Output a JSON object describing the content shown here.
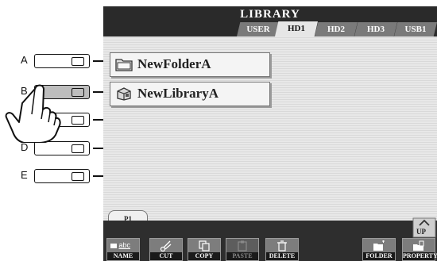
{
  "side_buttons": [
    {
      "label": "A"
    },
    {
      "label": "B"
    },
    {
      "label": ""
    },
    {
      "label": "D"
    },
    {
      "label": "E"
    }
  ],
  "screen": {
    "title": "LIBRARY",
    "tabs": [
      {
        "label": "USER"
      },
      {
        "label": "HD1",
        "active": true
      },
      {
        "label": "HD2"
      },
      {
        "label": "HD3"
      },
      {
        "label": "USB1"
      }
    ],
    "items": [
      {
        "name": "NewFolderA",
        "icon": "folder-icon"
      },
      {
        "name": "NewLibraryA",
        "icon": "library-icon"
      }
    ],
    "page_tab": "P1",
    "up_label": "UP",
    "functions": [
      {
        "label": "NAME",
        "icon": "name-abc-icon",
        "enabled": true
      },
      {
        "label": "CUT",
        "icon": "scissors-icon",
        "enabled": true
      },
      {
        "label": "COPY",
        "icon": "copy-icon",
        "enabled": true
      },
      {
        "label": "PASTE",
        "icon": "paste-icon",
        "enabled": false
      },
      {
        "label": "DELETE",
        "icon": "trash-icon",
        "enabled": true
      },
      {
        "label": "FOLDER",
        "icon": "new-folder-icon",
        "enabled": true
      },
      {
        "label": "PROPERTY",
        "icon": "property-icon",
        "enabled": true
      }
    ],
    "name_icon_text": "abc"
  }
}
